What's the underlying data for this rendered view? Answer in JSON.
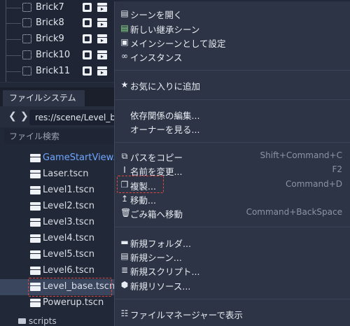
{
  "scene_tree": {
    "nodes": [
      {
        "label": "Brick7"
      },
      {
        "label": "Brick8"
      },
      {
        "label": "Brick9"
      },
      {
        "label": "Brick10"
      },
      {
        "label": "Brick11"
      }
    ]
  },
  "filesystem": {
    "tab_label": "ファイルシステム",
    "path_value": "res://scene/Level_base.tscn",
    "back_glyph": "❮",
    "forward_glyph": "❯",
    "search_placeholder": "ファイル検索",
    "files": [
      {
        "name": "GameStartView.tscn",
        "highlight": "blue"
      },
      {
        "name": "Laser.tscn"
      },
      {
        "name": "Level1.tscn"
      },
      {
        "name": "Level2.tscn"
      },
      {
        "name": "Level3.tscn"
      },
      {
        "name": "Level4.tscn"
      },
      {
        "name": "Level5.tscn"
      },
      {
        "name": "Level6.tscn"
      },
      {
        "name": "Level_base.tscn",
        "selected": true
      },
      {
        "name": "Powerup.tscn"
      }
    ],
    "partial_folder": "scripts"
  },
  "context_menu": {
    "items": {
      "open_scene": "シーンを開く",
      "new_inherited": "新しい継承シーン",
      "set_main": "メインシーンとして設定",
      "instance": "インスタンス",
      "add_favorite": "お気に入りに追加",
      "edit_deps": "依存関係の編集...",
      "view_owners": "オーナーを見る...",
      "copy_path": "パスをコピー",
      "copy_path_shortcut": "Shift+Command+C",
      "rename": "名前を変更...",
      "rename_shortcut": "F2",
      "duplicate": "複製...",
      "duplicate_shortcut": "Command+D",
      "move": "移動...",
      "trash": "ごみ箱へ移動",
      "trash_shortcut": "Command+BackSpace",
      "new_folder": "新規フォルダ...",
      "new_scene": "新規シーン...",
      "new_script": "新規スクリプト...",
      "new_resource": "新規リソース...",
      "show_in_file_manager": "ファイルマネージャーで表示"
    },
    "icons": {
      "open_scene": "clapperboard-icon",
      "new_inherited": "inherited-scene-icon",
      "set_main": "main-scene-icon",
      "instance": "link-icon",
      "add_favorite": "star-icon",
      "copy_path": "copy-icon",
      "rename": "rename-icon",
      "duplicate": "duplicate-icon",
      "move": "move-icon",
      "trash": "trash-icon",
      "new_folder": "folder-icon",
      "new_scene": "clapperboard-icon",
      "new_script": "script-icon",
      "new_resource": "resource-icon",
      "show_in_file_manager": "filesystem-icon"
    }
  },
  "colors": {
    "background": "#212837",
    "menu_bg": "#2c3445",
    "highlight_blue": "#6fa6ff",
    "annotation_red": "#e0483f"
  }
}
